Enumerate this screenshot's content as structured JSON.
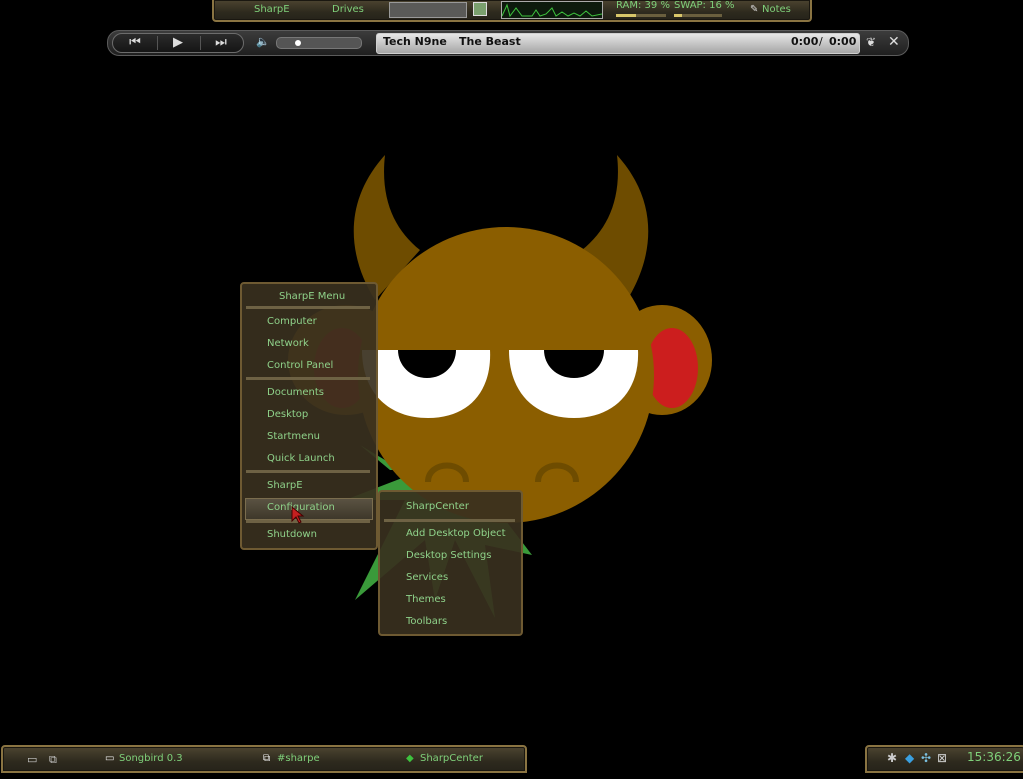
{
  "topbar": {
    "sharpe_label": "SharpE",
    "drives_label": "Drives",
    "ram_label": "RAM: 39 %",
    "swap_label": "SWAP: 16 %",
    "notes_label": "Notes",
    "ram_fraction": 0.39,
    "swap_fraction": 0.16
  },
  "player": {
    "artist": "Tech N9ne",
    "track": "The Beast",
    "time_current": "0:00",
    "time_separator": "/",
    "time_total": "0:00",
    "seek_fraction": 0.0
  },
  "mascot_colors": {
    "body": "#8b5e00",
    "horns": "#6e4c00",
    "cheeks": "#cc1e1e",
    "splash": "#3a9a3a"
  },
  "main_menu": {
    "title": "SharpE Menu",
    "items": [
      {
        "label": "Computer"
      },
      {
        "label": "Network"
      },
      {
        "label": "Control Panel"
      },
      {
        "label": "Documents"
      },
      {
        "label": "Desktop"
      },
      {
        "label": "Startmenu"
      },
      {
        "label": "Quick Launch"
      },
      {
        "label": "SharpE"
      },
      {
        "label": "Configuration"
      },
      {
        "label": "Shutdown"
      }
    ]
  },
  "config_submenu": {
    "items": [
      {
        "label": "SharpCenter"
      },
      {
        "label": "Add Desktop Object"
      },
      {
        "label": "Desktop Settings"
      },
      {
        "label": "Services"
      },
      {
        "label": "Themes"
      },
      {
        "label": "Toolbars"
      }
    ]
  },
  "taskbar": {
    "tasks": [
      {
        "label": "Songbird 0.3"
      },
      {
        "label": "#sharpe"
      },
      {
        "label": "SharpCenter"
      }
    ]
  },
  "tray": {
    "clock": "15:36:26"
  }
}
